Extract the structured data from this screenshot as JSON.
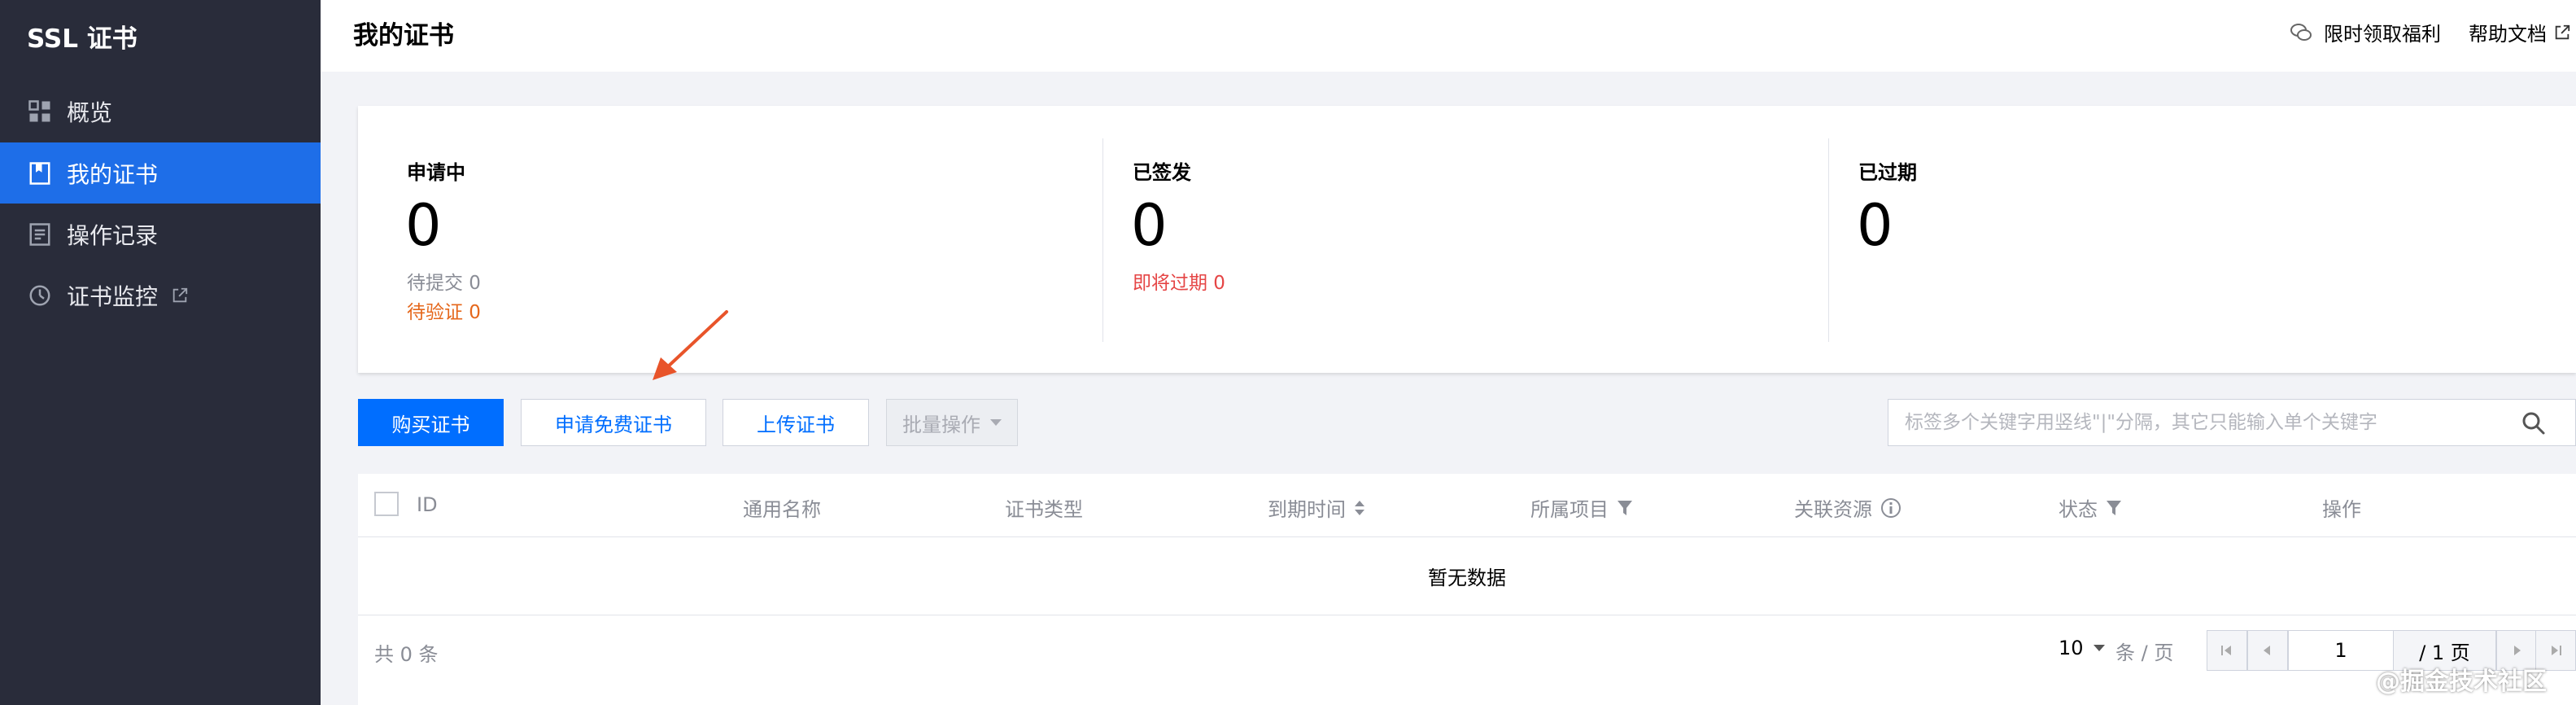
{
  "sidebar": {
    "brand": "SSL 证书",
    "items": [
      {
        "label": "概览",
        "icon": "dashboard-icon"
      },
      {
        "label": "我的证书",
        "icon": "certificate-icon",
        "active": true
      },
      {
        "label": "操作记录",
        "icon": "log-icon"
      },
      {
        "label": "证书监控",
        "icon": "monitor-icon",
        "external": true
      }
    ]
  },
  "header": {
    "title": "我的证书",
    "promo_label": "限时领取福利",
    "help_label": "帮助文档"
  },
  "stats": [
    {
      "title": "申请中",
      "value": "0",
      "sub1": "待提交 0",
      "sub2": "待验证 0"
    },
    {
      "title": "已签发",
      "value": "0",
      "sub1": "即将过期 0"
    },
    {
      "title": "已过期",
      "value": "0"
    }
  ],
  "toolbar": {
    "buy_label": "购买证书",
    "free_label": "申请免费证书",
    "upload_label": "上传证书",
    "batch_label": "批量操作",
    "search_placeholder": "标签多个关键字用竖线\"|\"分隔，其它只能输入单个关键字"
  },
  "table": {
    "columns": [
      "ID",
      "通用名称",
      "证书类型",
      "到期时间",
      "所属项目",
      "关联资源",
      "状态",
      "操作"
    ],
    "empty_text": "暂无数据"
  },
  "pagination": {
    "total_label": "共 0 条",
    "page_size": "10",
    "page_size_unit": "条 / 页",
    "current_page": "1",
    "total_pages_label": "/ 1 页"
  },
  "watermark": "@掘金技术社区",
  "colors": {
    "sidebar_bg": "#292c3a",
    "accent": "#006eff",
    "warning": "#e5671b",
    "danger": "#e54545",
    "arrow": "#e8542a"
  }
}
